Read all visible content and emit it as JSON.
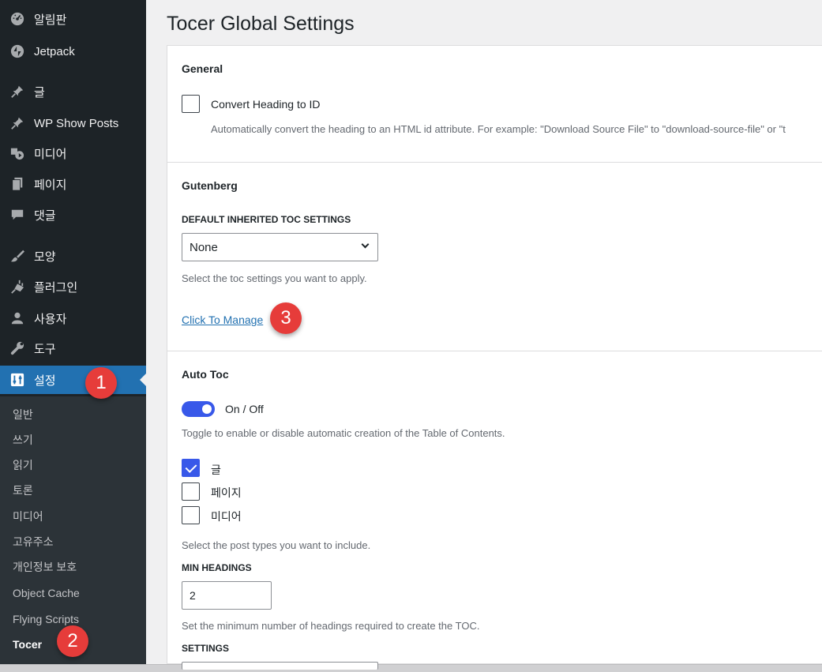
{
  "sidebar": {
    "items": [
      {
        "label": "알림판",
        "icon": "dashboard-icon"
      },
      {
        "label": "Jetpack",
        "icon": "jetpack-icon"
      },
      {
        "label": "글",
        "icon": "pin-icon"
      },
      {
        "label": "WP Show Posts",
        "icon": "pin-icon"
      },
      {
        "label": "미디어",
        "icon": "media-icon"
      },
      {
        "label": "페이지",
        "icon": "page-icon"
      },
      {
        "label": "댓글",
        "icon": "comment-icon"
      },
      {
        "label": "모양",
        "icon": "brush-icon"
      },
      {
        "label": "플러그인",
        "icon": "plugin-icon"
      },
      {
        "label": "사용자",
        "icon": "user-icon"
      },
      {
        "label": "도구",
        "icon": "wrench-icon"
      },
      {
        "label": "설정",
        "icon": "settings-icon"
      }
    ],
    "submenu": [
      "일반",
      "쓰기",
      "읽기",
      "토론",
      "미디어",
      "고유주소",
      "개인정보 보호",
      "Object Cache",
      "Flying Scripts",
      "Tocer"
    ],
    "active_item": "설정",
    "current_subitem": "Tocer"
  },
  "callouts": [
    "1",
    "2",
    "3"
  ],
  "page_title": "Tocer Global Settings",
  "general": {
    "title": "General",
    "convert_heading": {
      "label": "Convert Heading to ID",
      "checked": false,
      "help": "Automatically convert the heading to an HTML id attribute. For example: \"Download Source File\" to \"download-source-file\" or \"t"
    }
  },
  "gutenberg": {
    "title": "Gutenberg",
    "field_label": "DEFAULT INHERITED TOC SETTINGS",
    "select_value": "None",
    "help": "Select the toc settings you want to apply.",
    "link": "Click To Manage"
  },
  "auto_toc": {
    "title": "Auto Toc",
    "toggle_label": "On / Off",
    "toggle_on": true,
    "toggle_help": "Toggle to enable or disable automatic creation of the Table of Contents.",
    "post_types": [
      {
        "label": "글",
        "checked": true
      },
      {
        "label": "페이지",
        "checked": false
      },
      {
        "label": "미디어",
        "checked": false
      }
    ],
    "post_types_help": "Select the post types you want to include.",
    "min_headings_label": "MIN HEADINGS",
    "min_headings_value": "2",
    "min_headings_help": "Set the minimum number of headings required to create the TOC.",
    "settings_label": "SETTINGS"
  },
  "colors": {
    "sidebar_bg": "#1d2327",
    "submenu_bg": "#2c3338",
    "active_bg": "#2271b1",
    "toggle_accent": "#3858e9",
    "callout_red": "#e63c3a",
    "link_blue": "#2271b1"
  }
}
